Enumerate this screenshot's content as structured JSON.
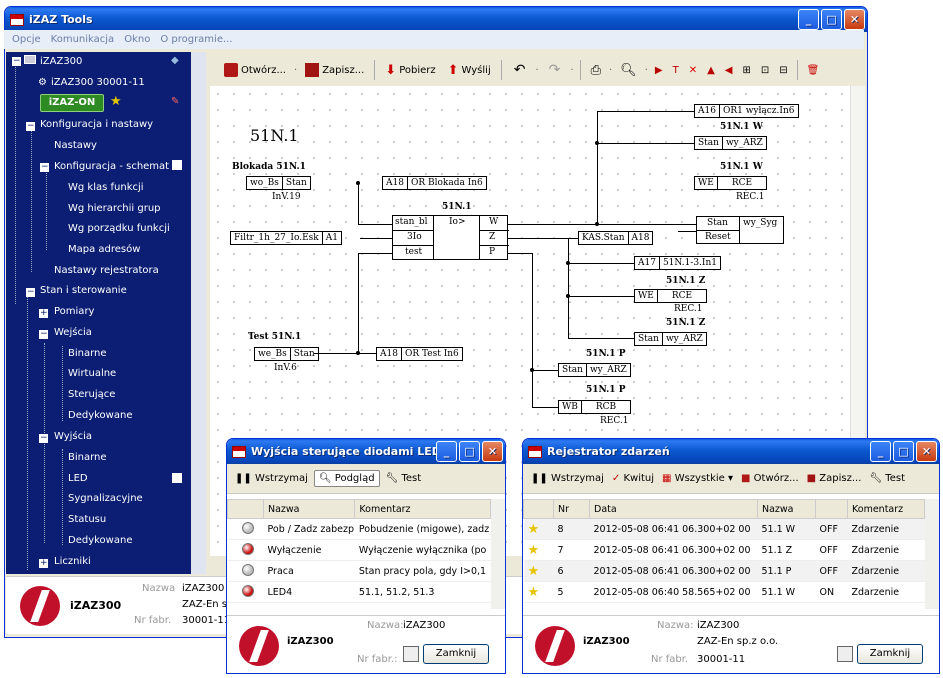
{
  "main": {
    "title": "iZAZ Tools",
    "menu": [
      "Opcje",
      "Komunikacja",
      "Okno",
      "O programie..."
    ]
  },
  "tree": {
    "root": "iZAZ300",
    "device": "iZAZ300 30001-11",
    "badge": "iZAZ-ON",
    "items": [
      "Konfiguracja i nastawy",
      "Nastawy",
      "Konfiguracja - schemat",
      "Wg klas funkcji",
      "Wg hierarchii grup",
      "Wg porządku funkcji",
      "Mapa adresów",
      "Nastawy rejestratora",
      "Stan i sterowanie",
      "Pomiary",
      "Wejścia",
      "Binarne",
      "Wirtualne",
      "Sterujące",
      "Dedykowane",
      "Wyjścia",
      "Binarne",
      "LED",
      "Sygnalizacyjne",
      "Statusu",
      "Dedykowane",
      "Liczniki"
    ]
  },
  "toolbar": {
    "open": "Otwórz...",
    "save": "Zapisz...",
    "download": "Pobierz",
    "send": "Wyślij"
  },
  "diagram": {
    "title": "51N.1",
    "blokada_title": "Blokada 51N.1",
    "wo_bs": "wo_Bs",
    "stan": "Stan",
    "inv19": "InV.19",
    "filtr": "Filtr_1h_27_Io.Esk",
    "a1": "A1",
    "a18": "A18",
    "or_blokada": "OR Blokada In6",
    "block_title": "51N.1",
    "stan_bl": "stan_bl",
    "io": "Io>",
    "w": "W",
    "z": "Z",
    "p": "P",
    "3io": "3Io",
    "test": "test",
    "kas_stan": "KAS.Stan",
    "a18b": "A18",
    "a16": "A16",
    "or1": "OR1 wyłącz.In6",
    "n51w": "51N.1 W",
    "stan_wyarz": "Stan",
    "wy_arz": "wy_ARZ",
    "we": "WE",
    "rce": "RCE",
    "rec1": "REC.1",
    "sw_stan": "Stan",
    "wy_syg": "wy_Syg",
    "reset": "Reset",
    "a17": "A17",
    "n51_13": "51N.1-3.In1",
    "n51z": "51N.1 Z",
    "n51p": "51N.1 P",
    "wb": "WB",
    "rcb": "RCB",
    "rec_label": "REC.1",
    "test_title": "Test 51N.1",
    "we_bs": "we_Bs",
    "inv6": "InV.6",
    "a18c": "A18",
    "or_test": "OR Test In6"
  },
  "status": {
    "app": "iZAZ300",
    "name_label": "Nazwa",
    "name": "iZAZ300",
    "company": "ZAZ-En sp.z o.o.",
    "serial_label": "Nr fabr.",
    "serial": "30001-11"
  },
  "led_win": {
    "title": "Wyjścia sterujące diodami LED",
    "tabs": [
      "Wstrzymaj",
      "Podgląd",
      "Test"
    ],
    "cols": [
      "Nazwa",
      "Komentarz"
    ],
    "rows": [
      {
        "name": "Pob / Zadz zabezp",
        "comment": "Pobudzenie (migowe), zadz",
        "color": "#bbbbbb"
      },
      {
        "name": "Wyłączenie",
        "comment": "Wyłączenie wyłącznika (po",
        "color": "#cc1111"
      },
      {
        "name": "Praca",
        "comment": "Stan pracy pola, gdy I>0,1",
        "color": "#bbbbbb"
      },
      {
        "name": "LED4",
        "comment": "51.1, 51.2, 51.3",
        "color": "#cc1111"
      }
    ],
    "close": "Zamknij",
    "name_label": "Nazwa:",
    "name": "iZAZ300",
    "serial_label": "Nr fabr.:",
    "app": "iZAZ300"
  },
  "rej_win": {
    "title": "Rejestrator zdarzeń",
    "tools": [
      "Wstrzymaj",
      "Kwituj",
      "Wszystkie",
      "Otwórz...",
      "Zapisz...",
      "Test"
    ],
    "cols": [
      "Nr",
      "Data",
      "Nazwa",
      "",
      "Komentarz"
    ],
    "rows": [
      {
        "nr": "8",
        "date": "2012-05-08 06:41 06.300+02 00",
        "name": "51.1 W",
        "state": "OFF",
        "comment": "Zdarzenie"
      },
      {
        "nr": "7",
        "date": "2012-05-08 06:41 06.300+02 00",
        "name": "51.1 Z",
        "state": "OFF",
        "comment": "Zdarzenie"
      },
      {
        "nr": "6",
        "date": "2012-05-08 06:41 06.300+02 00",
        "name": "51.1 P",
        "state": "OFF",
        "comment": "Zdarzenie"
      },
      {
        "nr": "5",
        "date": "2012-05-08 06:40 58.565+02 00",
        "name": "51.1 W",
        "state": "ON",
        "comment": "Zdarzenie"
      }
    ],
    "close": "Zamknij",
    "name_label": "Nazwa:",
    "name": "iZAZ300",
    "company": "ZAZ-En sp.z o.o.",
    "serial_label": "Nr fabr.",
    "serial": "30001-11",
    "app": "iZAZ300"
  }
}
